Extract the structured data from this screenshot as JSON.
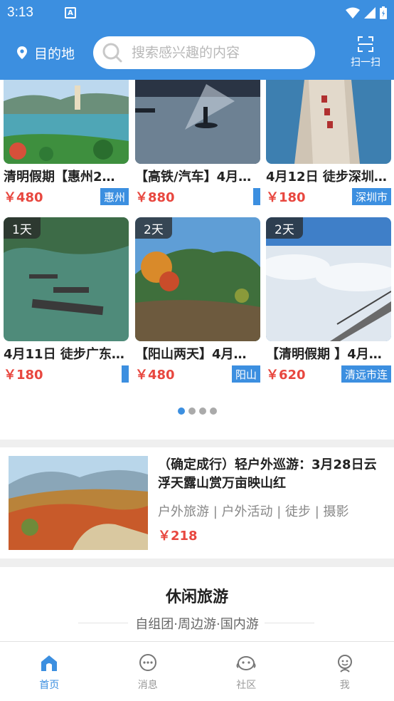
{
  "status_bar": {
    "time": "3:13",
    "notification_icon": "A"
  },
  "header": {
    "destination_label": "目的地",
    "search_placeholder": "搜索感兴趣的内容",
    "scan_label": "扫一扫"
  },
  "cards": [
    {
      "title": "清明假期【惠州2…",
      "price": "￥480",
      "tag": "惠州",
      "days": ""
    },
    {
      "title": "【高铁/汽车】4月…",
      "price": "￥880",
      "tag": "",
      "days": ""
    },
    {
      "title": "4月12日 徒步深圳…",
      "price": "￥180",
      "tag": "深圳市",
      "days": ""
    },
    {
      "title": "4月11日 徒步广东…",
      "price": "￥180",
      "tag": "",
      "days": "1天"
    },
    {
      "title": "【阳山两天】4月…",
      "price": "￥480",
      "tag": "阳山",
      "days": "2天"
    },
    {
      "title": "【清明假期 】4月…",
      "price": "￥620",
      "tag": "清远市连",
      "days": "2天"
    }
  ],
  "pagination": {
    "count": 4,
    "active": 0
  },
  "featured": {
    "title": "（确定成行）轻户外巡游：3月28日云浮天露山赏万亩映山红",
    "categories": "户外旅游 | 户外活动 | 徒步 | 摄影",
    "price": "￥218"
  },
  "leisure": {
    "title": "休闲旅游",
    "subtitle": "自组团·周边游·国内游"
  },
  "bottom_nav": [
    {
      "label": "首页",
      "icon": "home-icon",
      "active": true
    },
    {
      "label": "消息",
      "icon": "message-icon",
      "active": false
    },
    {
      "label": "社区",
      "icon": "community-icon",
      "active": false
    },
    {
      "label": "我",
      "icon": "profile-icon",
      "active": false
    }
  ],
  "colors": {
    "primary": "#3c8fe0",
    "price": "#e8473f"
  }
}
